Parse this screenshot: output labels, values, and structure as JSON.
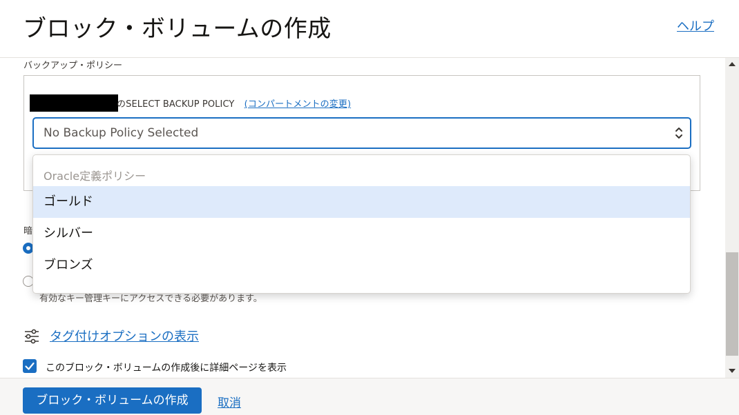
{
  "header": {
    "title": "ブロック・ボリュームの作成",
    "help_link": "ヘルプ"
  },
  "backup": {
    "section_label": "バックアップ・ポリシー",
    "select_label": "のSELECT BACKUP POLICY",
    "change_compartment_link": "(コンパートメントの変更)",
    "select_value": "No Backup Policy Selected"
  },
  "dropdown": {
    "group_label": "Oracle定義ポリシー",
    "options": [
      "ゴールド",
      "シルバー",
      "ブロンズ"
    ],
    "selected_index": 0
  },
  "encryption": {
    "label_fragment": "暗",
    "hint": "有効なキー管理キーにアクセスできる必要があります。"
  },
  "tags": {
    "link": "タグ付けオプションの表示"
  },
  "checkbox": {
    "label": "このブロック・ボリュームの作成後に詳細ページを表示",
    "checked": true
  },
  "footer": {
    "create_button": "ブロック・ボリュームの作成",
    "cancel_link": "取消"
  },
  "colors": {
    "accent": "#1a6ec2",
    "selected_option_bg": "#deeafb",
    "footer_bg": "#f7f6f5"
  }
}
